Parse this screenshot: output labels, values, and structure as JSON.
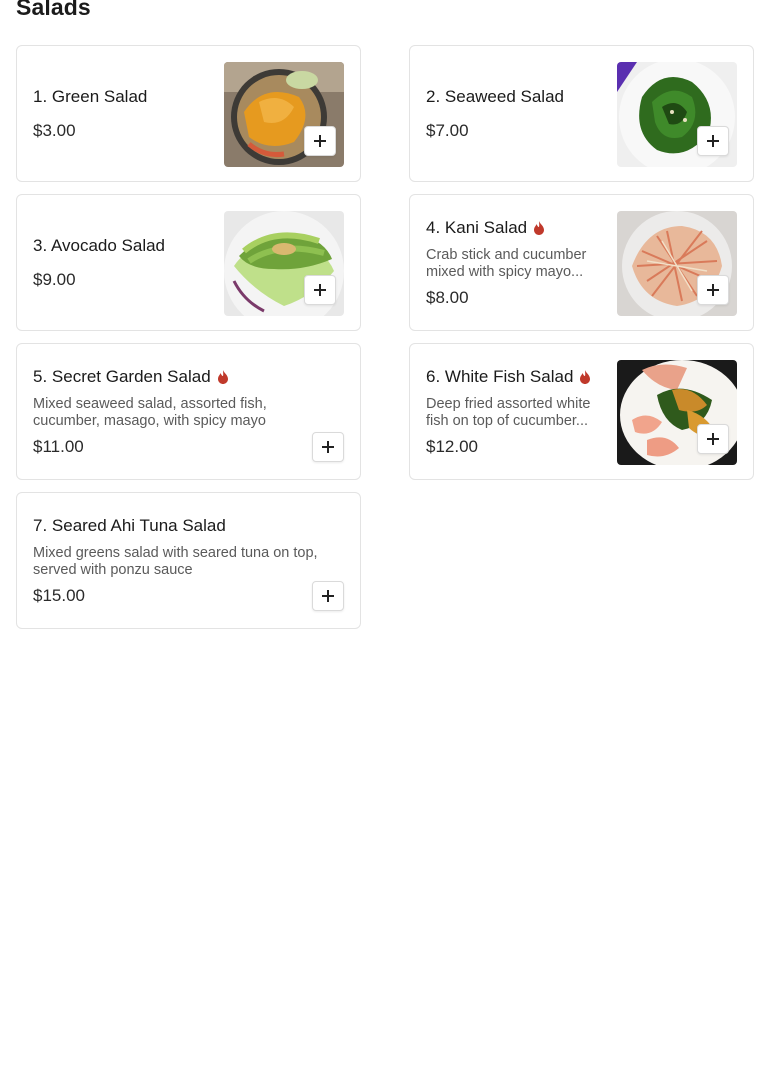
{
  "section": {
    "title": "Salads"
  },
  "items": [
    {
      "name": "1. Green Salad",
      "price": "$3.00",
      "description": "",
      "spicy": false,
      "image": "green-salad-photo"
    },
    {
      "name": "2. Seaweed Salad",
      "price": "$7.00",
      "description": "",
      "spicy": false,
      "image": "seaweed-salad-photo"
    },
    {
      "name": "3. Avocado Salad",
      "price": "$9.00",
      "description": "",
      "spicy": false,
      "image": "avocado-salad-photo"
    },
    {
      "name": "4. Kani Salad",
      "price": "$8.00",
      "description": "Crab stick and cucumber mixed with spicy mayo...",
      "spicy": true,
      "image": "kani-salad-photo"
    },
    {
      "name": "5. Secret Garden Salad",
      "price": "$11.00",
      "description": "Mixed seaweed salad, assorted fish, cucumber, masago, with spicy mayo",
      "spicy": true,
      "image": ""
    },
    {
      "name": "6. White Fish Salad",
      "price": "$12.00",
      "description": "Deep fried assorted white fish on top of cucumber...",
      "spicy": true,
      "image": "white-fish-salad-photo"
    },
    {
      "name": "7. Seared Ahi Tuna Salad",
      "price": "$15.00",
      "description": "Mixed greens salad with seared tuna on top, served with ponzu sauce",
      "spicy": false,
      "image": ""
    }
  ],
  "colors": {
    "spicy": "#c0392b",
    "border": "#e3e3e3"
  }
}
